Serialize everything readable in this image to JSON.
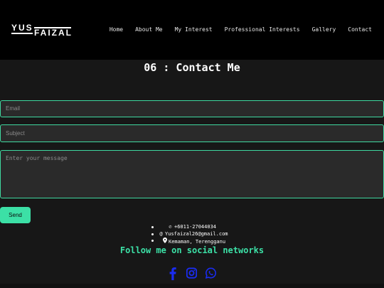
{
  "header": {
    "logo_top": "YUS",
    "logo_bottom": "FAIZAL"
  },
  "nav": {
    "items": [
      "Home",
      "About Me",
      "My Interest",
      "Professional Interests",
      "Gallery",
      "Contact"
    ]
  },
  "section": {
    "title": "06 : Contact Me"
  },
  "form": {
    "email_placeholder": "Email",
    "subject_placeholder": "Subject",
    "message_placeholder": "Enter your message",
    "send_label": "Send"
  },
  "contact": {
    "phone": "+6011-27044034",
    "email": "Yusfaizal26@gmail.com",
    "location": "Kemaman, Terengganu",
    "icons": [
      "phone-icon",
      "at-icon",
      "location-pin-icon"
    ]
  },
  "social": {
    "heading": "Follow me on social networks",
    "icons": [
      "facebook-icon",
      "instagram-icon",
      "whatsapp-icon"
    ],
    "colors": {
      "facebook": "#1a2cf0",
      "instagram": "#1a2cf0",
      "whatsapp": "#1a2cf0"
    }
  },
  "colors": {
    "accent": "#3ce0a6",
    "background": "#171717",
    "navbar": "#000000"
  }
}
